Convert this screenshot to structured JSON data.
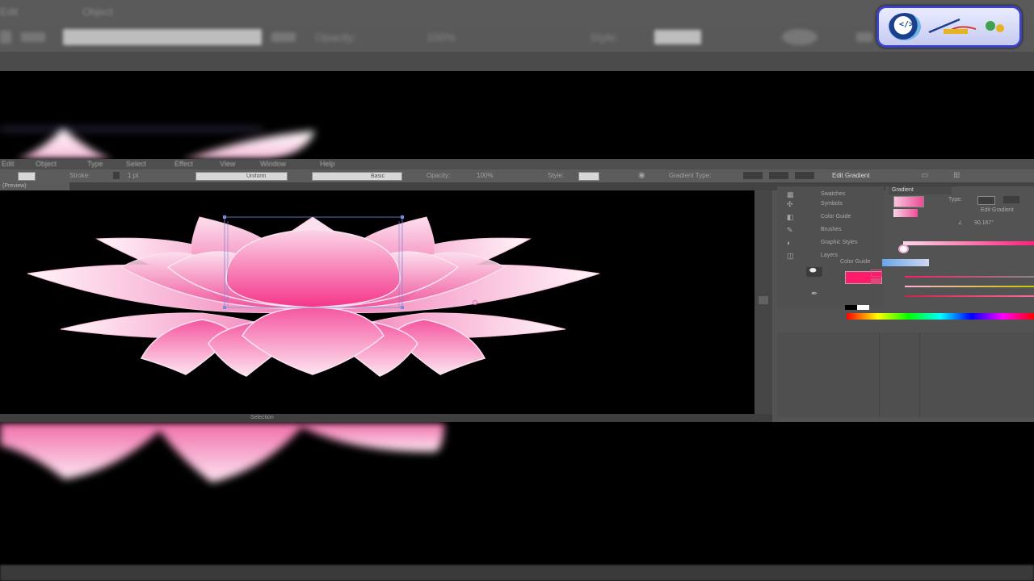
{
  "background_app": {
    "menu": [
      "Edit",
      "Object",
      "Type",
      "Select",
      "Effect",
      "View",
      "Window",
      "Help"
    ],
    "controls": [
      "Basic",
      "Opacity:",
      "100%",
      "Style:"
    ]
  },
  "window": {
    "menu": [
      "Edit",
      "Object",
      "Type",
      "Select",
      "Effect",
      "View",
      "Window",
      "Help"
    ],
    "control_bar": {
      "stroke_label": "Stroke:",
      "stroke_value": "1 pt",
      "uniform": "Uniform",
      "basic": "Basic",
      "opacity_label": "Opacity:",
      "opacity_value": "100%",
      "style_label": "Style:",
      "gradient_type_label": "Gradient Type:",
      "edit_gradient": "Edit Gradient"
    },
    "doc_tab": "(Preview)",
    "status_text": "Selection",
    "panels": {
      "icon_items": [
        {
          "icon": "swatches-icon",
          "label": "Swatches"
        },
        {
          "icon": "symbols-icon",
          "label": "Symbols"
        },
        {
          "icon": "color-guide-icon",
          "label": "Color Guide"
        },
        {
          "icon": "brushes-icon",
          "label": "Brushes"
        },
        {
          "icon": "graphic-styles-icon",
          "label": "Graphic Styles"
        },
        {
          "icon": "layers-icon",
          "label": "Layers"
        }
      ],
      "gradient": {
        "tab": "Gradient",
        "type_label": "Type:",
        "edit_label": "Edit Gradient",
        "angle_value": "90.167°",
        "start_color": "#fbd7ea",
        "end_color": "#ff1f78"
      },
      "color": {
        "tab": "Color Guide",
        "fill_color": "#ff1a6b"
      }
    }
  },
  "artwork": {
    "petal_light": "#fbe3ef",
    "petal_dark": "#f04d99",
    "center_dark": "#f5358a"
  }
}
